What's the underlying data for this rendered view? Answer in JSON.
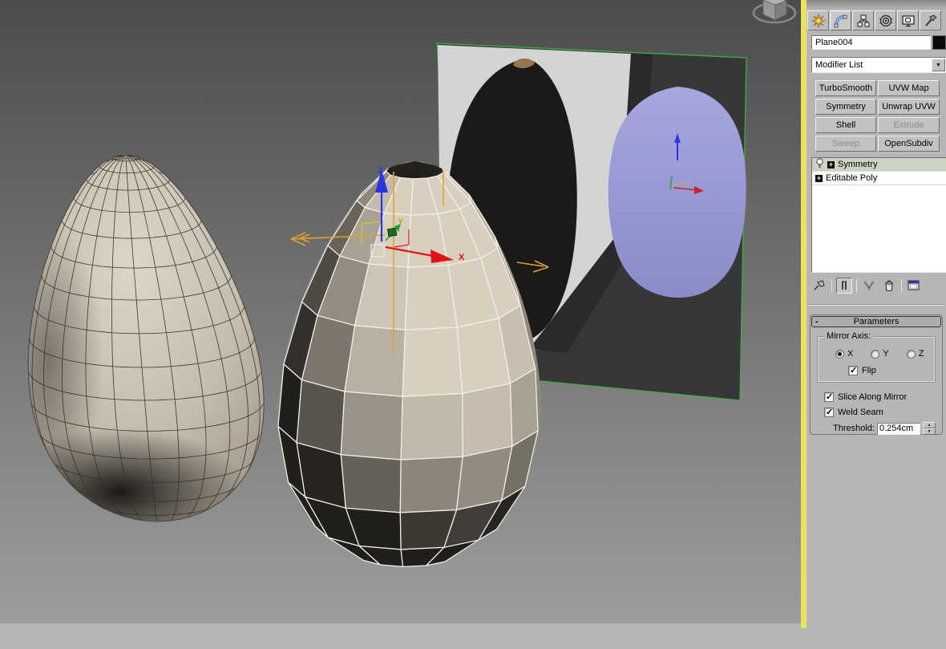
{
  "glyphs": {
    "check": "✓",
    "dropdown_arrow": "▼",
    "spinner_up": "▲",
    "spinner_down": "▼",
    "plus": "+",
    "minus": "-"
  },
  "command_panel": {
    "tabs": [
      {
        "icon": "create-icon",
        "name": "Create"
      },
      {
        "icon": "modify-icon",
        "name": "Modify",
        "active": true
      },
      {
        "icon": "hierarchy-icon",
        "name": "Hierarchy"
      },
      {
        "icon": "motion-icon",
        "name": "Motion"
      },
      {
        "icon": "display-icon",
        "name": "Display"
      },
      {
        "icon": "utilities-icon",
        "name": "Utilities"
      }
    ],
    "object_name": "Plane004",
    "object_color": "#0a0a0a",
    "modifier_list_label": "Modifier List",
    "modifier_buttons": [
      {
        "label": "TurboSmooth",
        "enabled": true
      },
      {
        "label": "UVW Map",
        "enabled": true
      },
      {
        "label": "Symmetry",
        "enabled": true
      },
      {
        "label": "Unwrap UVW",
        "enabled": true
      },
      {
        "label": "Shell",
        "enabled": true
      },
      {
        "label": "Extrude",
        "enabled": false
      },
      {
        "label": "Sweep",
        "enabled": false
      },
      {
        "label": "OpenSubdiv",
        "enabled": true
      }
    ],
    "modifier_stack": {
      "items": [
        {
          "label": "Symmetry",
          "selected": true,
          "bulb": true,
          "expandable": true
        },
        {
          "label": "Editable Poly",
          "selected": false,
          "expandable": true
        }
      ]
    },
    "stack_toolbar": [
      {
        "icon": "pin-stack-icon",
        "name": "Pin Stack"
      },
      {
        "icon": "show-end-result-icon",
        "name": "Show End Result",
        "pressed": true
      },
      {
        "icon": "make-unique-icon",
        "name": "Make Unique"
      },
      {
        "icon": "remove-modifier-icon",
        "name": "Remove Modifier"
      },
      {
        "icon": "configure-modifier-sets-icon",
        "name": "Configure Modifier Sets"
      }
    ],
    "parameters": {
      "title": "Parameters",
      "mirror_axis": {
        "label": "Mirror Axis:",
        "options": [
          {
            "label": "X",
            "selected": true
          },
          {
            "label": "Y",
            "selected": false
          },
          {
            "label": "Z",
            "selected": false
          }
        ],
        "flip": {
          "label": "Flip",
          "checked": true
        }
      },
      "slice_along_mirror": {
        "label": "Slice Along Mirror",
        "checked": true
      },
      "weld_seam": {
        "label": "Weld Seam",
        "checked": true
      },
      "threshold": {
        "label": "Threshold:",
        "value": "0.254cm"
      }
    }
  },
  "viewport": {
    "gizmo": {
      "x_label": "X",
      "y_label": "Y",
      "z_label": "Z"
    },
    "objects": [
      "smoothed egg mesh",
      "editable poly egg (selected)",
      "reference plane with seed photo and silhouette"
    ],
    "colors": {
      "bg_top": "#4c4c4c",
      "bg_bottom": "#9d9d9d",
      "axis_x": "#e01414",
      "axis_y": "#18a825",
      "axis_z": "#2a35e0",
      "axis_y_label": "#c8a50a",
      "symmetry_gizmo": "#dfa32f",
      "selection_wire": "#f3f0e9",
      "plane_edge": "#3fae3f",
      "silhouette_blue": "#9597d5",
      "seed_black": "#1c1a18",
      "active_border_yellow": "#e9e45f"
    }
  }
}
